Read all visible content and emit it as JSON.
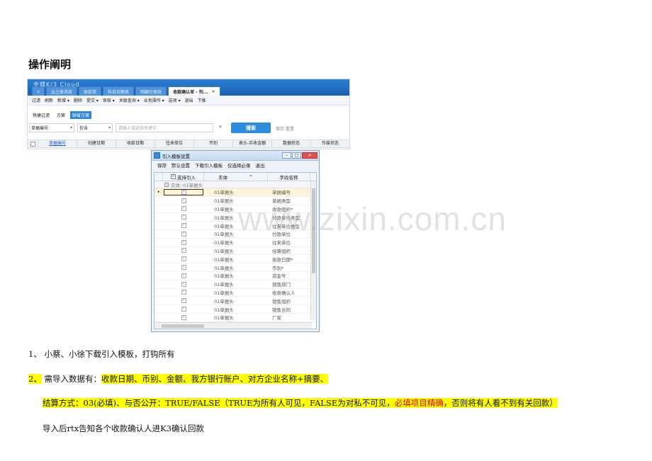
{
  "heading": "操作阐明",
  "erp": {
    "logo": "金蝶K/3 Cloud",
    "tabs": [
      "云之家消息",
      "收款单",
      "科目余额表",
      "明细分类账",
      "收款确认单 - 列..."
    ],
    "tab_close": "×",
    "toolbar": [
      "过滤",
      "刷新",
      "新增 ▾",
      "删除",
      "提交 ▾",
      "审核 ▾",
      "关联查询 ▾",
      "业务操作 ▾",
      "选项 ▾",
      "退出",
      "下推"
    ],
    "filters": [
      "快捷过滤",
      "方案",
      "缺省方案"
    ],
    "field_combo": "单据编号",
    "op_combo": "包含",
    "search_placeholder": "请输入或选择关键字",
    "clear_icon": "¥",
    "search_button": "搜索",
    "save_reset": "保存  重置",
    "columns": [
      "单据编号",
      "创建日期",
      "收款日期",
      "往来单位",
      "币别",
      "表头-实收金额",
      "数据状态",
      "作废状态"
    ]
  },
  "dialog": {
    "title": "引入模板设置",
    "menu": [
      "保存",
      "默认设置",
      "下载引入模板",
      "仅选择必录",
      "退出"
    ],
    "columns": [
      "支持引入",
      "实体",
      "字段名称"
    ],
    "group_label": "实体: 01单据头",
    "rows": [
      {
        "entity": "01单据头",
        "field": "单据编号"
      },
      {
        "entity": "01单据头",
        "field": "单据类型"
      },
      {
        "entity": "01单据头",
        "field": "收款组织*"
      },
      {
        "entity": "01单据头",
        "field": "付款单位类型"
      },
      {
        "entity": "01单据头",
        "field": "往来单位类型"
      },
      {
        "entity": "01单据头",
        "field": "付款单位"
      },
      {
        "entity": "01单据头",
        "field": "往来单位"
      },
      {
        "entity": "01单据头",
        "field": "结算组织"
      },
      {
        "entity": "01单据头",
        "field": "收款日期*"
      },
      {
        "entity": "01单据头",
        "field": "币别*"
      },
      {
        "entity": "01单据头",
        "field": "资金号"
      },
      {
        "entity": "01单据头",
        "field": "销售部门"
      },
      {
        "entity": "01单据头",
        "field": "收款确认人"
      },
      {
        "entity": "01单据头",
        "field": "销售组织"
      },
      {
        "entity": "01单据头",
        "field": "销售合同"
      },
      {
        "entity": "01单据头",
        "field": "厂家"
      }
    ]
  },
  "watermark": "www.zixin.com.cn",
  "paragraphs": {
    "p1": "1、 小蔡、小徐下载引入模板，打钩所有",
    "p2_prefix": "2、",
    "p2_lead": " 需导入数据有：",
    "p2_highlight": "收款日期、币别、金额、我方银行账户、对方企业名称+摘要、",
    "p3_a": "结算方式：03(必填)、与否公开：TRUE/FALSE（TRUE为所有人可见，FALSE为对私不可见，",
    "p3_red": "必填项目精确",
    "p3_b": "，否则将有人看不到有关回款）",
    "p4": "导入后rtx告知各个收款确认人进K3确认回款"
  }
}
